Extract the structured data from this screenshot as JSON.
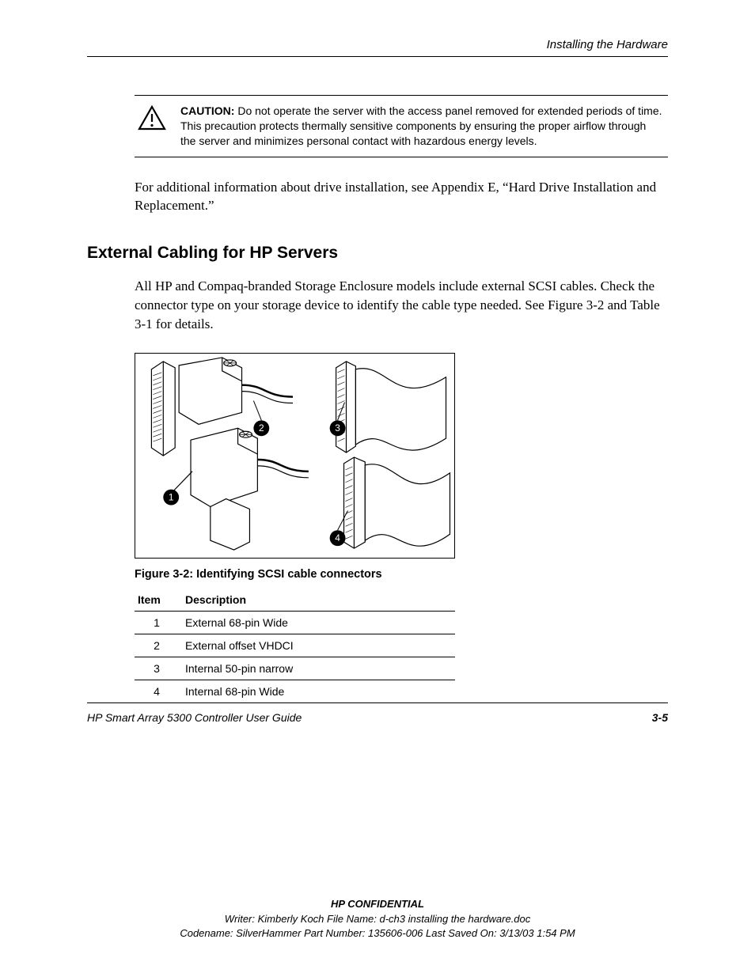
{
  "header": {
    "running": "Installing the Hardware"
  },
  "caution": {
    "label": "CAUTION:",
    "text": "Do not operate the server with the access panel removed for extended periods of time. This precaution protects thermally sensitive components by ensuring the proper airflow through the server and minimizes personal contact with hazardous energy levels."
  },
  "para1": "For additional information about drive installation, see Appendix E, “Hard Drive Installation and Replacement.”",
  "section_heading": "External Cabling for HP Servers",
  "para2": "All HP and Compaq-branded Storage Enclosure models include external SCSI cables. Check the connector type on your storage device to identify the cable type needed. See Figure 3-2 and Table 3-1 for details.",
  "figure": {
    "callouts": [
      "1",
      "2",
      "3",
      "4"
    ],
    "caption": "Figure 3-2:  Identifying SCSI cable connectors"
  },
  "table": {
    "headers": {
      "item": "Item",
      "desc": "Description"
    },
    "rows": [
      {
        "item": "1",
        "desc": "External 68-pin Wide"
      },
      {
        "item": "2",
        "desc": "External offset VHDCI"
      },
      {
        "item": "3",
        "desc": "Internal 50-pin narrow"
      },
      {
        "item": "4",
        "desc": "Internal 68-pin Wide"
      }
    ]
  },
  "footer": {
    "guide": "HP Smart Array 5300 Controller User Guide",
    "page": "3-5"
  },
  "confidential": {
    "title": "HP CONFIDENTIAL",
    "line1": "Writer: Kimberly Koch File Name: d-ch3 installing the hardware.doc",
    "line2": "Codename: SilverHammer Part Number: 135606-006 Last Saved On: 3/13/03 1:54 PM"
  }
}
